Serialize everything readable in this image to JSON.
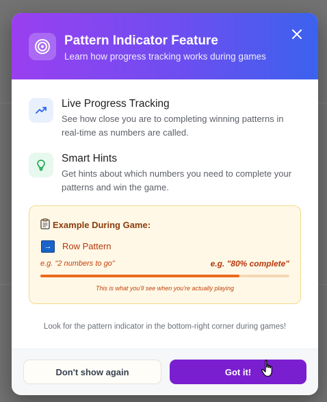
{
  "modal": {
    "title": "Pattern Indicator Feature",
    "subtitle": "Learn how progress tracking works during games",
    "close_icon": "close-icon",
    "header_icon": "target-icon"
  },
  "features": [
    {
      "icon": "trending-up-icon",
      "title": "Live Progress Tracking",
      "description": "See how close you are to completing winning patterns in real-time as numbers are called."
    },
    {
      "icon": "lightbulb-icon",
      "title": "Smart Hints",
      "description": "Get hints about which numbers you need to complete your patterns and win the game."
    }
  ],
  "example": {
    "title": "Example During Game:",
    "pattern_label": "Row Pattern",
    "left_hint": "e.g. \"2 numbers to go\"",
    "right_hint": "e.g. \"80% complete\"",
    "progress_fraction": 0.8,
    "note": "This is what you'll see when you're actually playing"
  },
  "footer_hint": "Look for the pattern indicator in the bottom-right corner during games!",
  "buttons": {
    "dismiss": "Don't show again",
    "confirm": "Got it!"
  },
  "colors": {
    "header_gradient_start": "#9a3ff0",
    "header_gradient_end": "#3b62ee",
    "primary_button": "#7a1fcf",
    "progress_fill": "#ea6c1f"
  }
}
